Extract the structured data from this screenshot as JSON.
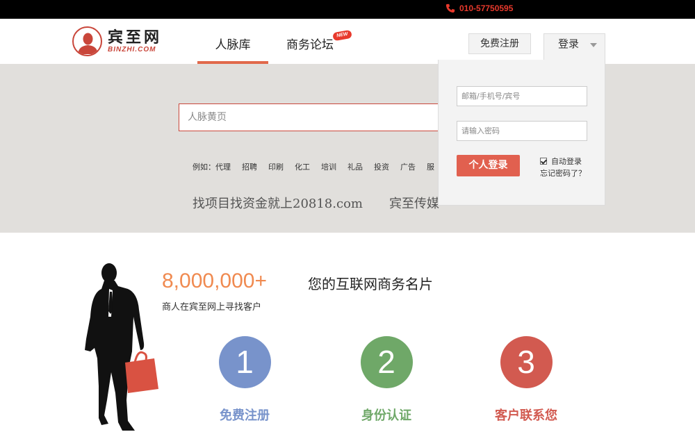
{
  "topbar": {
    "phone": "010-57750595",
    "phone_icon": "phone-icon"
  },
  "logo": {
    "cn": "宾至网",
    "en": "BINZHI.COM"
  },
  "nav": {
    "items": [
      {
        "label": "人脉库"
      },
      {
        "label": "商务论坛"
      }
    ],
    "new_badge": "NEW"
  },
  "auth": {
    "register": "免费注册",
    "login": "登录"
  },
  "search": {
    "placeholder": "人脉黄页"
  },
  "examples": {
    "lead": "例如：",
    "tags": [
      "代理",
      "招聘",
      "印刷",
      "化工",
      "培训",
      "礼品",
      "投资",
      "广告",
      "服"
    ]
  },
  "slogan": {
    "line1": "找项目找资金就上20818.com",
    "line2": "宾至传媒"
  },
  "login_panel": {
    "user_placeholder": "邮箱/手机号/宾号",
    "pass_placeholder": "请输入密码",
    "submit": "个人登录",
    "remember": "自动登录",
    "forgot": "忘记密码了？"
  },
  "stats": {
    "count": "8,000,000+",
    "desc": "商人在宾至网上寻找客户",
    "tagline": "您的互联网商务名片"
  },
  "steps": [
    {
      "num": "1",
      "label": "免费注册",
      "color": "#7893cb"
    },
    {
      "num": "2",
      "label": "身份认证",
      "color": "#6fa868"
    },
    {
      "num": "3",
      "label": "客户联系您",
      "color": "#d25a50"
    }
  ],
  "colors": {
    "accent": "#e1604f",
    "phone": "#e8392c",
    "count": "#f08a50"
  }
}
